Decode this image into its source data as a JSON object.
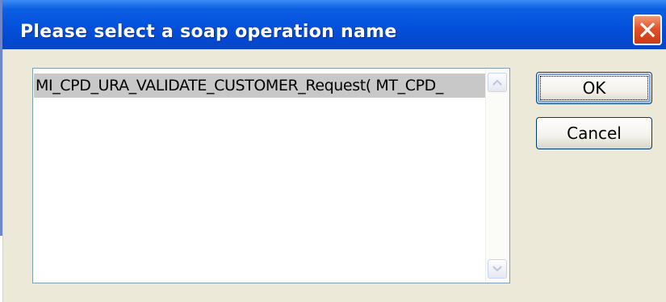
{
  "dialog": {
    "title": "Please select a soap operation name",
    "close_icon": "close-icon",
    "titlebar_color": "#0450dc",
    "close_color": "#e3522a"
  },
  "listbox": {
    "items": [
      {
        "label": "MI_CPD_URA_VALIDATE_CUSTOMER_Request( MT_CPD_",
        "selected": true
      }
    ],
    "scroll_up_icon": "chevron-up-icon",
    "scroll_down_icon": "chevron-down-icon"
  },
  "buttons": {
    "ok_label": "OK",
    "cancel_label": "Cancel"
  }
}
